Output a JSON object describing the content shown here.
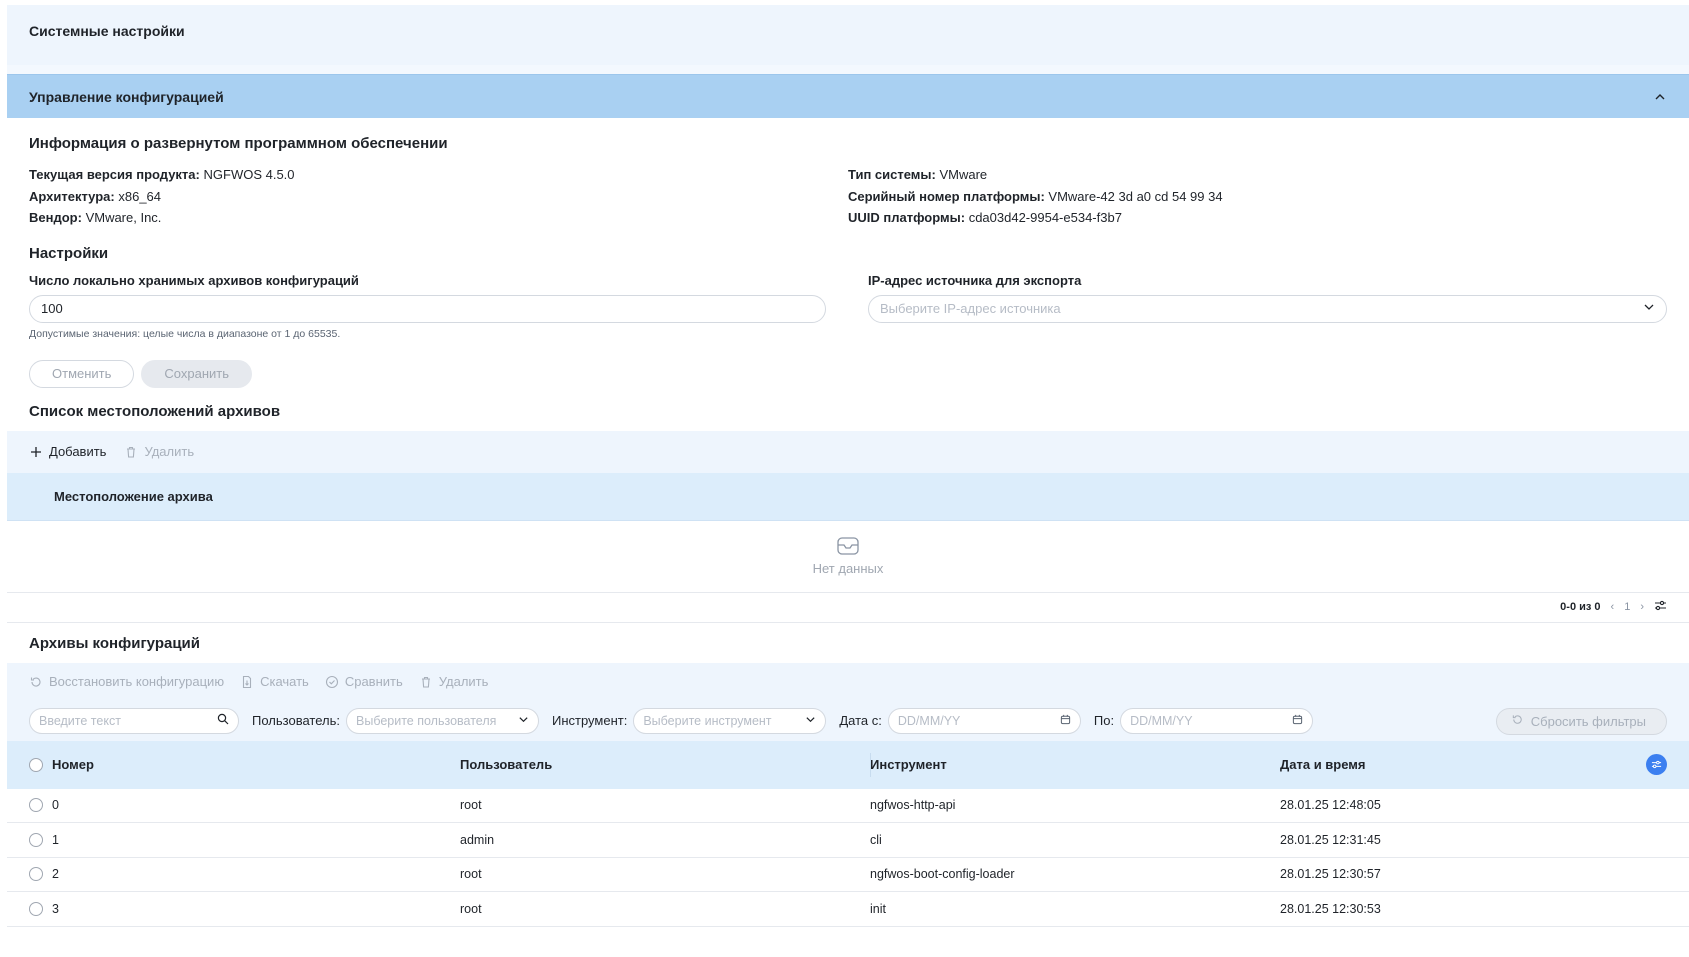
{
  "header": {
    "title": "Системные настройки"
  },
  "accordion": {
    "title": "Управление конфигурацией"
  },
  "software_info": {
    "title": "Информация о развернутом программном обеспечении",
    "left": [
      {
        "label": "Текущая версия продукта:",
        "value": "NGFWOS 4.5.0"
      },
      {
        "label": "Архитектура:",
        "value": "x86_64"
      },
      {
        "label": "Вендор:",
        "value": "VMware, Inc."
      }
    ],
    "right": [
      {
        "label": "Тип системы:",
        "value": "VMware"
      },
      {
        "label": "Серийный номер платформы:",
        "value": "VMware-42 3d a0 cd 54 99 34"
      },
      {
        "label": "UUID платформы:",
        "value": "cda03d42-9954-e534-f3b7"
      }
    ]
  },
  "settings": {
    "title": "Настройки",
    "archive_count_label": "Число локально хранимых архивов конфигураций",
    "archive_count_value": "100",
    "archive_count_hint": "Допустимые значения: целые числа в диапазоне от 1 до 65535.",
    "export_ip_label": "IP-адрес источника для экспорта",
    "export_ip_placeholder": "Выберите IP-адрес источника",
    "cancel_label": "Отменить",
    "save_label": "Сохранить"
  },
  "locations": {
    "title": "Список местоположений архивов",
    "add_label": "Добавить",
    "delete_label": "Удалить",
    "column": "Местоположение архива",
    "empty_text": "Нет данных",
    "pager_count": "0-0 из 0",
    "page": "1"
  },
  "archives": {
    "title": "Архивы конфигураций",
    "toolbar": {
      "restore_label": "Восстановить конфигурацию",
      "download_label": "Скачать",
      "compare_label": "Сравнить",
      "delete_label": "Удалить"
    },
    "filters": {
      "search_placeholder": "Введите текст",
      "user_label": "Пользователь",
      "user_placeholder": "Выберите пользователя",
      "tool_label": "Инструмент",
      "tool_placeholder": "Выберите инструмент",
      "date_from_label": "Дата с",
      "date_from_placeholder": "DD/MM/YY",
      "date_to_label": "По",
      "date_to_placeholder": "DD/MM/YY",
      "reset_label": "Сбросить фильтры"
    },
    "columns": [
      "Номер",
      "Пользователь",
      "Инструмент",
      "Дата и время"
    ],
    "rows": [
      {
        "number": "0",
        "user": "root",
        "tool": "ngfwos-http-api",
        "datetime": "28.01.25 12:48:05"
      },
      {
        "number": "1",
        "user": "admin",
        "tool": "cli",
        "datetime": "28.01.25 12:31:45"
      },
      {
        "number": "2",
        "user": "root",
        "tool": "ngfwos-boot-config-loader",
        "datetime": "28.01.25 12:30:57"
      },
      {
        "number": "3",
        "user": "root",
        "tool": "init",
        "datetime": "28.01.25 12:30:53"
      }
    ]
  },
  "colors": {
    "accordion_bg": "#a9d0f2",
    "accent": "#3b7ff0",
    "panel_bg": "#eef5fd"
  }
}
